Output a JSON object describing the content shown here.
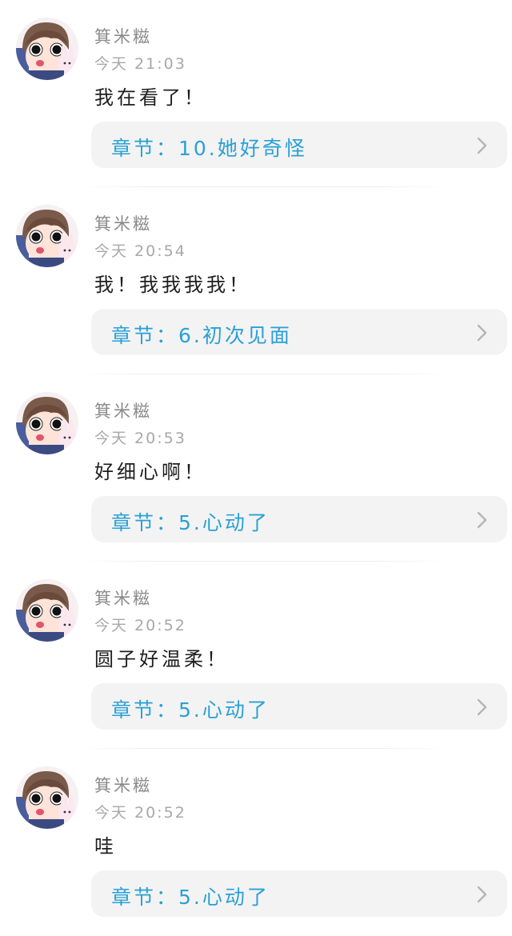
{
  "comments": [
    {
      "username": "箕米糍",
      "time": "今天 21:03",
      "text": "我在看了！",
      "chapter": "章节：10.她好奇怪"
    },
    {
      "username": "箕米糍",
      "time": "今天 20:54",
      "text": "我！我我我我！",
      "chapter": "章节：6.初次见面"
    },
    {
      "username": "箕米糍",
      "time": "今天 20:53",
      "text": "好细心啊！",
      "chapter": "章节：5.心动了"
    },
    {
      "username": "箕米糍",
      "time": "今天 20:52",
      "text": "圆子好温柔！",
      "chapter": "章节：5.心动了"
    },
    {
      "username": "箕米糍",
      "time": "今天 20:52",
      "text": "哇",
      "chapter": "章节：5.心动了"
    }
  ],
  "colors": {
    "chapter_text": "#2aa0d6",
    "chapter_background": "#f3f3f3",
    "username": "#8a8a8a",
    "time": "#a8a8a8"
  },
  "icons": {
    "chapter_arrow": "chevron-right-icon",
    "avatar": "cartoon-girl-with-bunny-avatar"
  }
}
